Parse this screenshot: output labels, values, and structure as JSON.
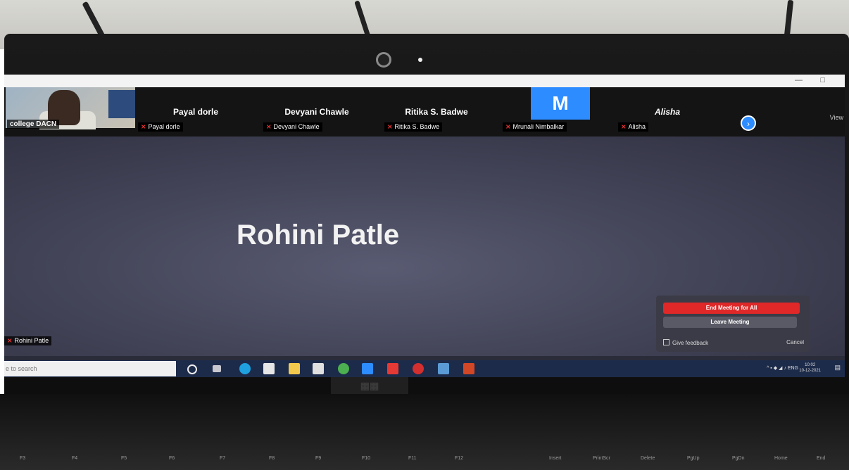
{
  "participants": [
    {
      "name": "Payal dorle",
      "label": "Payal dorle"
    },
    {
      "name": "Devyani Chawle",
      "label": "Devyani Chawle"
    },
    {
      "name": "Ritika S. Badwe",
      "label": "Ritika S. Badwe"
    },
    {
      "name": "",
      "avatar_letter": "M",
      "label": "Mrunali Nimbalkar"
    },
    {
      "name": "Alisha",
      "label": "Alisha"
    }
  ],
  "self_view": {
    "label": "college DACN"
  },
  "view_button": "View",
  "speaker": {
    "name": "Rohini Patle",
    "label": "Rohini Patle"
  },
  "end_popup": {
    "end_all": "End Meeting for All",
    "leave": "Leave Meeting",
    "feedback": "Give feedback",
    "cancel": "Cancel"
  },
  "taskbar": {
    "search_placeholder": "e to search",
    "tray": "ENG",
    "time": "10:02",
    "date": "10-12-2021"
  },
  "laptop_keys": [
    "F3",
    "F4",
    "F5",
    "F6",
    "F7",
    "F8",
    "F9",
    "F10",
    "F11",
    "F12",
    "Insert",
    "PrintScr",
    "Delete",
    "PgUp",
    "PgDn",
    "Home",
    "End"
  ],
  "colors": {
    "accent_blue": "#2d8cff",
    "end_red": "#e02828",
    "mic_muted": "#e33333"
  }
}
